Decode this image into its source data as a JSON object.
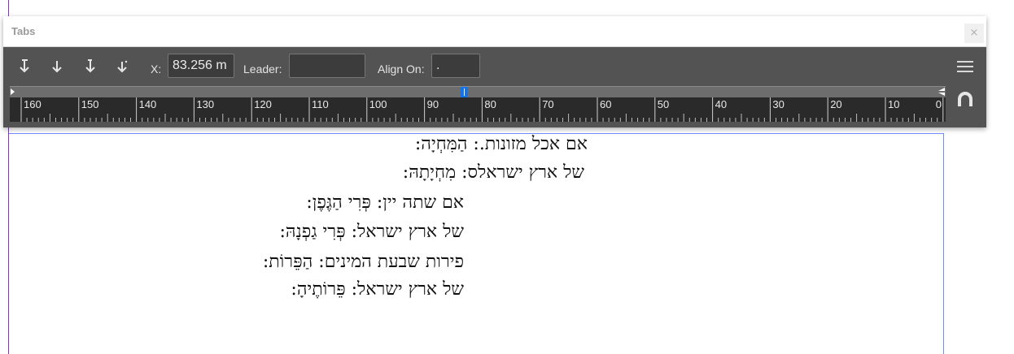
{
  "panel": {
    "title": "Tabs",
    "close_label": "×",
    "tab_buttons": [
      {
        "name": "left-justified-tab-icon"
      },
      {
        "name": "center-justified-tab-icon"
      },
      {
        "name": "right-justified-tab-icon"
      },
      {
        "name": "align-to-decimal-tab-icon"
      }
    ],
    "x_label": "X:",
    "x_value": "83.256 m",
    "leader_label": "Leader:",
    "leader_value": "",
    "align_on_label": "Align On:",
    "align_on_value": ".",
    "ruler_labels": [
      "160",
      "150",
      "140",
      "130",
      "120",
      "110",
      "100",
      "90",
      "80",
      "70",
      "60",
      "50",
      "40",
      "30",
      "20",
      "10",
      "0"
    ],
    "menu_icon": "hamburger-menu-icon",
    "snap_icon": "magnet-icon",
    "accent_color": "#1473e6"
  },
  "document": {
    "lines": [
      "אם אכל מזונות.: הַמִּחְיָה:",
      "של ארץ ישראלס: מִחְיָתָהּ:",
      "אם שתה יין: פְּרִי הַגֶּפֶן:",
      "של ארץ ישראל: פְּרִי גַפְנָהּ:",
      "פירות שבעת המינים: הַפֵּרוֹת:",
      "של ארץ ישראל: פֵּרוֹתֶיהָ:"
    ]
  }
}
